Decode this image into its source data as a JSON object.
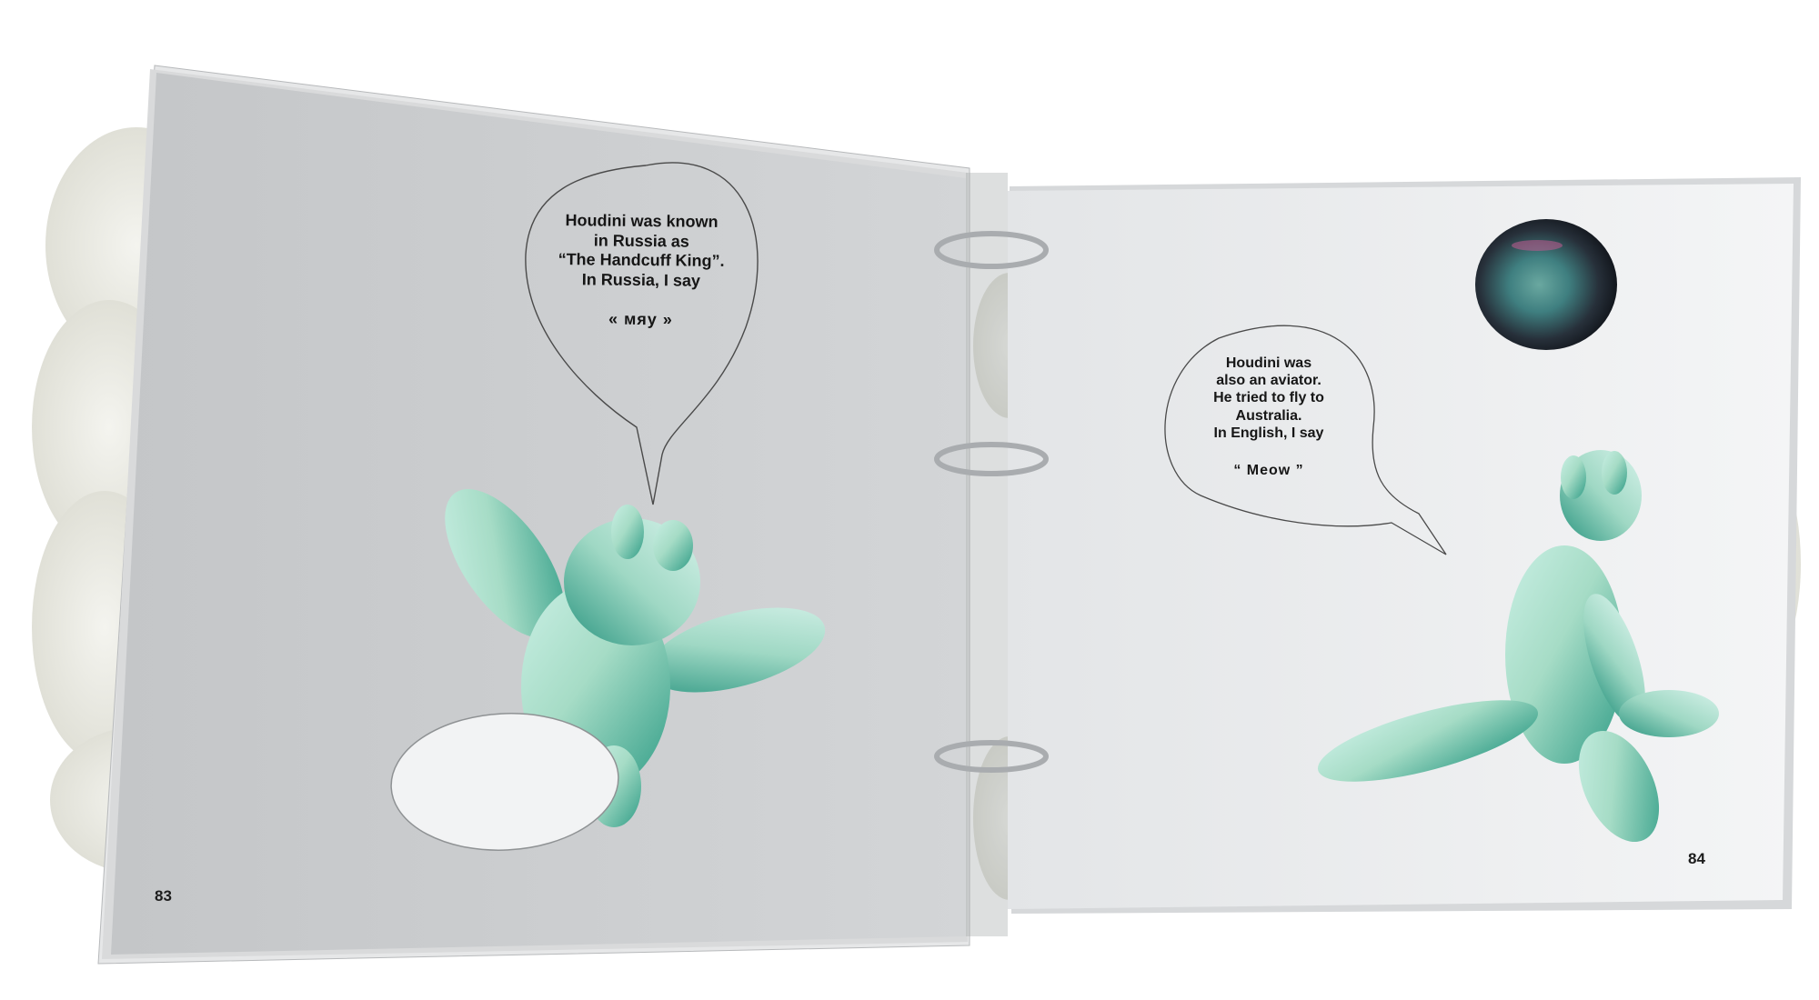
{
  "book": {
    "left_page": {
      "speech_lines": [
        "Houdini was known",
        "in Russia as",
        "“The Handcuff King”.",
        "In Russia, I say"
      ],
      "word": "« мяу »",
      "page_number": "83"
    },
    "right_page": {
      "speech_lines": [
        "Houdini was",
        "also an aviator.",
        "He tried to fly to",
        "Australia.",
        "In English, I say"
      ],
      "word": "“ Meow ”",
      "page_number": "84"
    }
  },
  "colors": {
    "page_gray": "#c9cbcd",
    "page_white": "#eef0f2",
    "balloon_mint": "#9fd8c4",
    "balloon_teal": "#2f9c86",
    "ring_metal": "#a9acaf"
  }
}
